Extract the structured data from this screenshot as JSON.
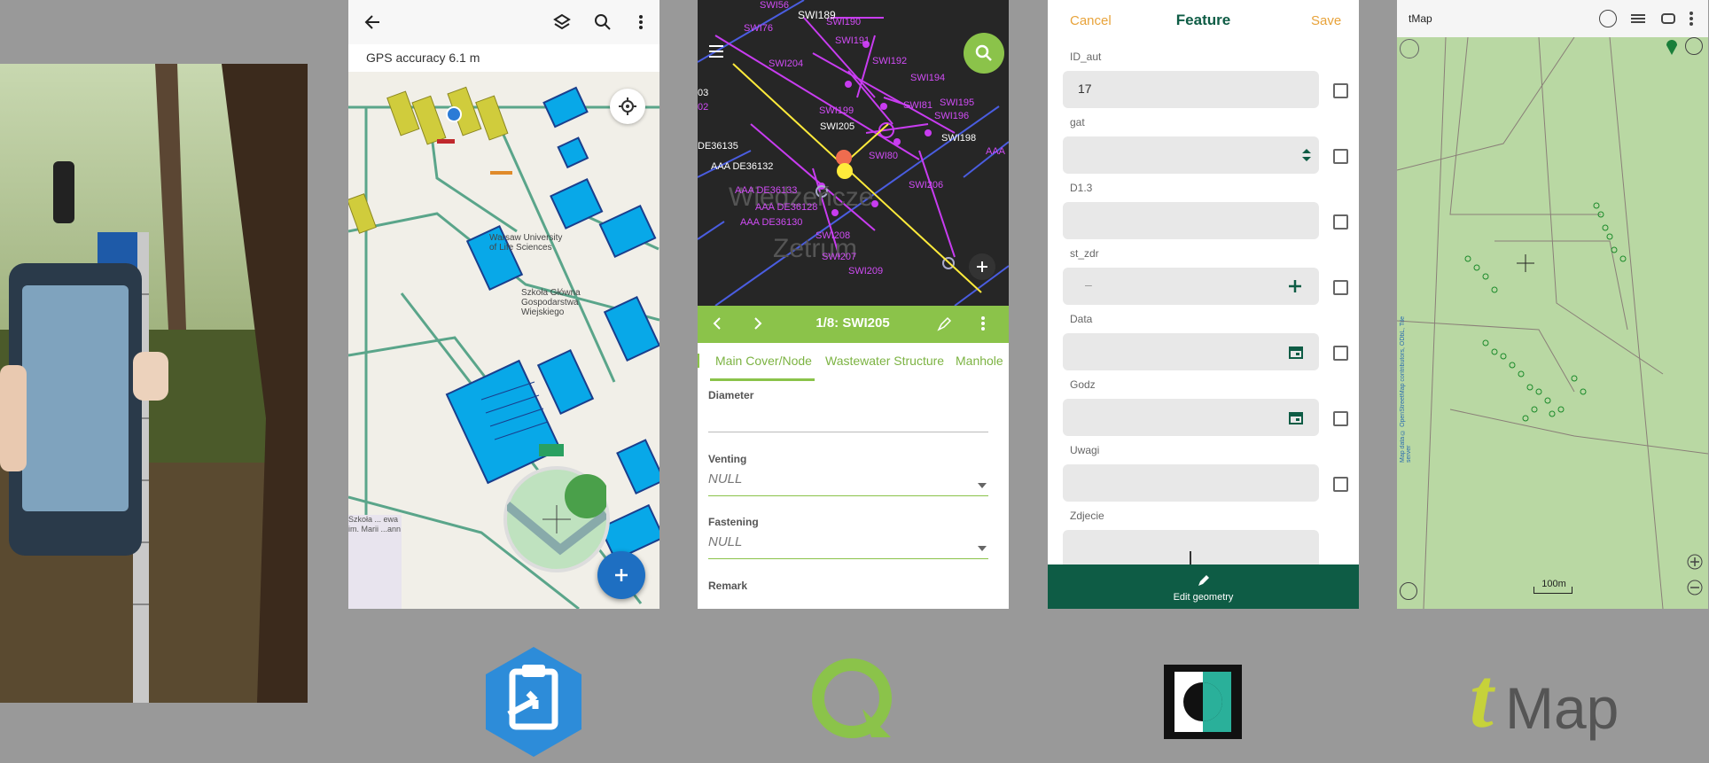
{
  "survey123": {
    "gps_accuracy": "GPS accuracy 6.1 m",
    "campus_label": "Warsaw University of Life Sciences",
    "campus_label_2": "Szkoła Główna Gospodarstwa Wiejskiego",
    "bottom_left_label": "Szkoła ... ewa im. Marii ...ann"
  },
  "qfield": {
    "feature_title": "1/8: SWI205",
    "tabs": [
      "Main Cover/Node",
      "Wastewater Structure",
      "Manhole"
    ],
    "fields": [
      {
        "label": "Diameter",
        "value": ""
      },
      {
        "label": "Venting",
        "value": "NULL"
      },
      {
        "label": "Fastening",
        "value": "NULL"
      },
      {
        "label": "Remark",
        "value": ""
      }
    ],
    "map_labels": [
      "SWI56",
      "SWI189",
      "SWI76",
      "SWI190",
      "SWI191",
      "SWI204",
      "SWI192",
      "SWI194",
      "SWI81",
      "SWI195",
      "SWI199",
      "SWI196",
      "SWI205",
      "SWI198",
      "DE36135",
      "SWI80",
      "AAA DE36132",
      "SWI206",
      "AAA DE36133",
      "AAA DE36128",
      "AAA DE36130",
      "SWI208",
      "SWI207",
      "SWI209",
      "03",
      "02",
      "AAA"
    ]
  },
  "feature_form": {
    "cancel": "Cancel",
    "title": "Feature",
    "save": "Save",
    "fields": [
      {
        "label": "ID_aut",
        "value": "17"
      },
      {
        "label": "gat",
        "value": ""
      },
      {
        "label": "D1.3",
        "value": ""
      },
      {
        "label": "st_zdr",
        "value": "–"
      },
      {
        "label": "Data",
        "value": ""
      },
      {
        "label": "Godz",
        "value": ""
      },
      {
        "label": "Uwagi",
        "value": ""
      },
      {
        "label": "Zdjecie",
        "value": ""
      }
    ],
    "edit_geometry": "Edit geometry",
    "accent": "#e8a33a",
    "brand": "#0e5c45"
  },
  "tmap": {
    "title": "tMap",
    "scale": "100m",
    "attribution": "Map data © OpenStreetMap contributors, ODbL, Tile server"
  },
  "logos": {
    "qfield_color": "#8bc34a",
    "survey_color": "#2d8cd9",
    "tmap_text": "Map",
    "tmap_t": "t"
  }
}
